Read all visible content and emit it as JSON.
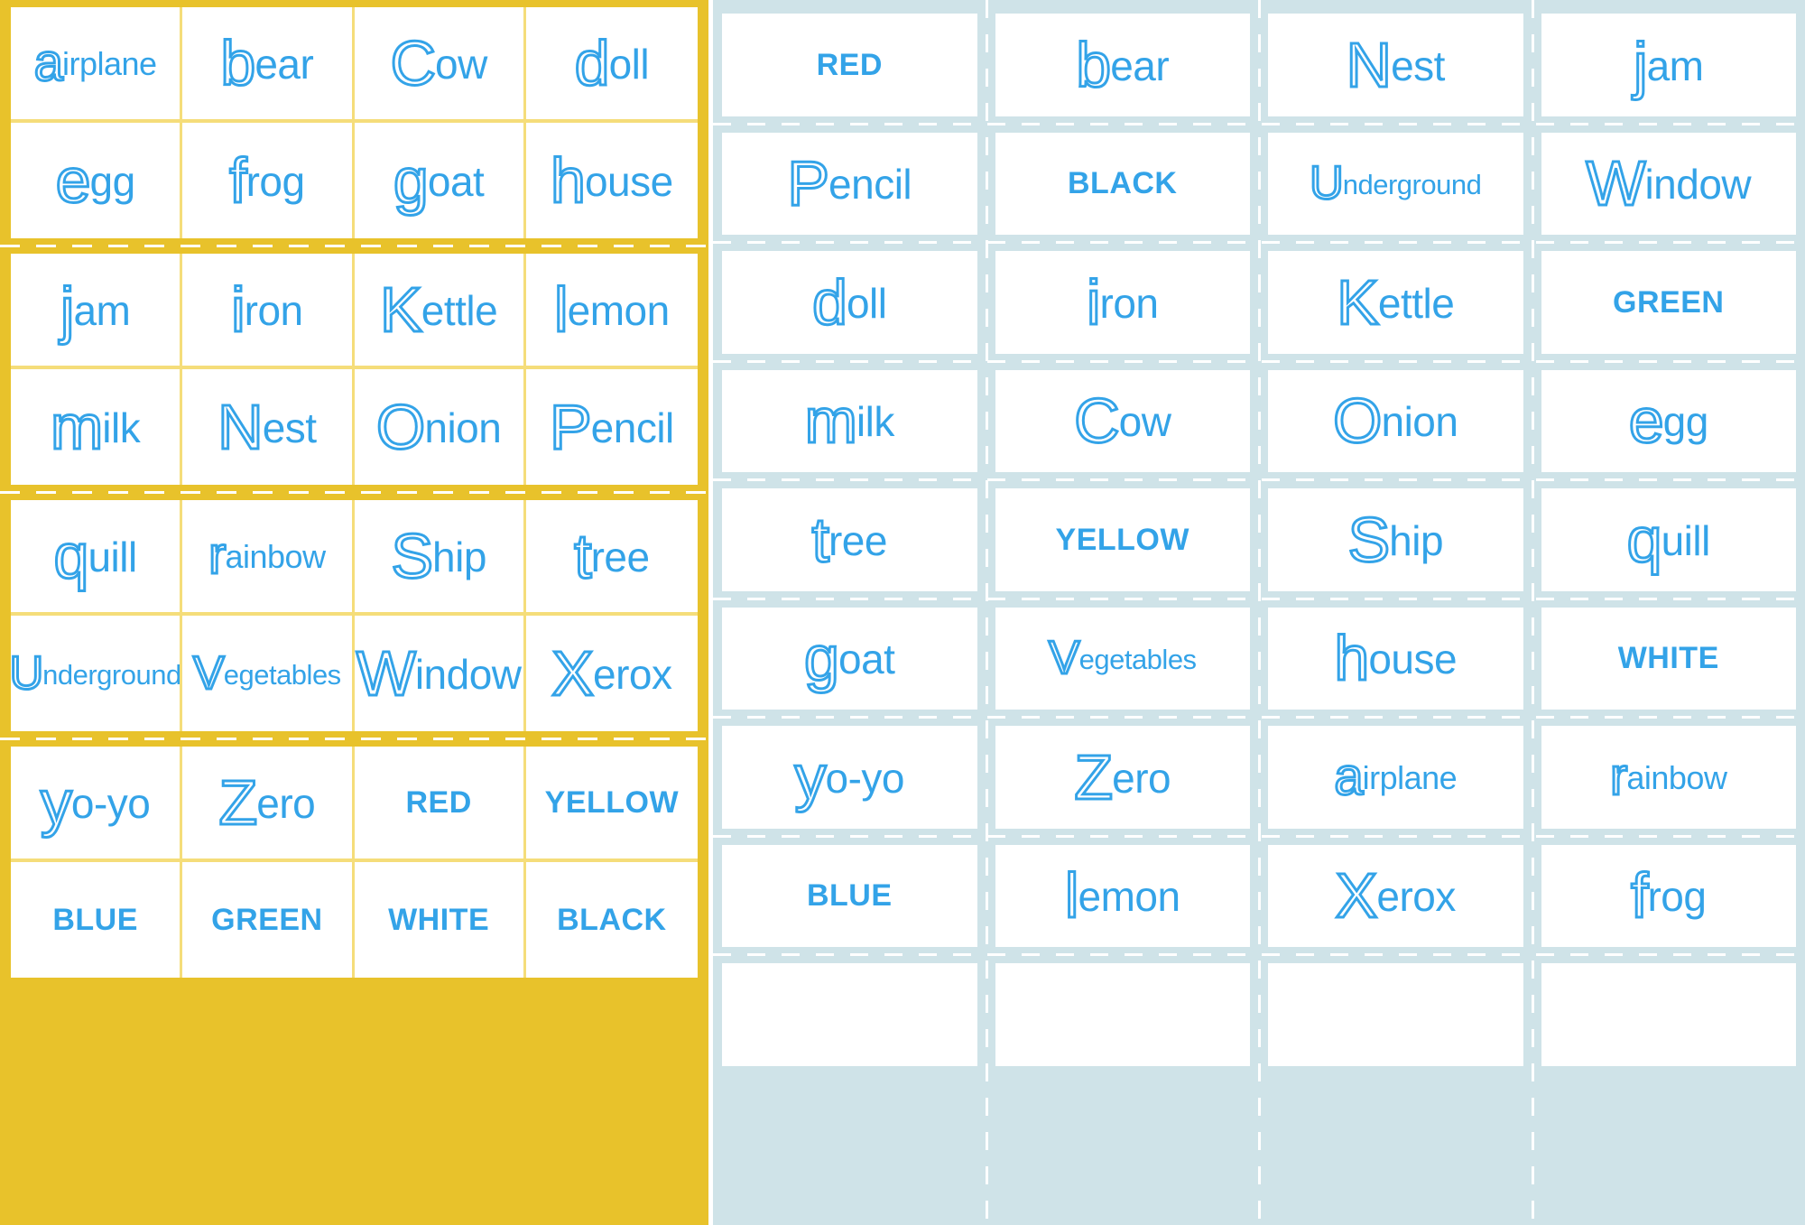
{
  "meta": {
    "accent_yellow": "#e8c22b",
    "accent_yellow_light": "#f5dd7a",
    "accent_blue_bg": "#cfe3e8",
    "word_blue": "#33a3e8",
    "card_white": "#ffffff"
  },
  "left_sheet": {
    "name": "alphabet-flashcard-sheet-yellow",
    "columns": 4,
    "blocks": [
      {
        "rows": [
          [
            {
              "text": "airplane",
              "initial": "a",
              "rest": "irplane",
              "style": "picture"
            },
            {
              "text": "bear",
              "initial": "b",
              "rest": "ear",
              "style": "picture"
            },
            {
              "text": "Cow",
              "initial": "C",
              "rest": "ow",
              "style": "picture"
            },
            {
              "text": "doll",
              "initial": "d",
              "rest": "oll",
              "style": "picture"
            }
          ],
          [
            {
              "text": "egg",
              "initial": "e",
              "rest": "gg",
              "style": "picture"
            },
            {
              "text": "frog",
              "initial": "f",
              "rest": "rog",
              "style": "picture"
            },
            {
              "text": "goat",
              "initial": "g",
              "rest": "oat",
              "style": "picture"
            },
            {
              "text": "house",
              "initial": "h",
              "rest": "ouse",
              "style": "picture"
            }
          ]
        ]
      },
      {
        "rows": [
          [
            {
              "text": "jam",
              "initial": "j",
              "rest": "am",
              "style": "picture"
            },
            {
              "text": "iron",
              "initial": "i",
              "rest": "ron",
              "style": "picture"
            },
            {
              "text": "Kettle",
              "initial": "K",
              "rest": "ettle",
              "style": "picture"
            },
            {
              "text": "lemon",
              "initial": "l",
              "rest": "emon",
              "style": "picture"
            }
          ],
          [
            {
              "text": "milk",
              "initial": "m",
              "rest": "ilk",
              "style": "picture"
            },
            {
              "text": "Nest",
              "initial": "N",
              "rest": "est",
              "style": "picture"
            },
            {
              "text": "Onion",
              "initial": "O",
              "rest": "nion",
              "style": "picture"
            },
            {
              "text": "Pencil",
              "initial": "P",
              "rest": "encil",
              "style": "picture"
            }
          ]
        ]
      },
      {
        "rows": [
          [
            {
              "text": "quill",
              "initial": "q",
              "rest": "uill",
              "style": "picture"
            },
            {
              "text": "rainbow",
              "initial": "r",
              "rest": "ainbow",
              "style": "picture"
            },
            {
              "text": "Ship",
              "initial": "S",
              "rest": "hip",
              "style": "picture"
            },
            {
              "text": "tree",
              "initial": "t",
              "rest": "ree",
              "style": "picture"
            }
          ],
          [
            {
              "text": "Underground",
              "initial": "U",
              "rest": "nderground",
              "style": "picture"
            },
            {
              "text": "Vegetables",
              "initial": "V",
              "rest": "egetables",
              "style": "picture"
            },
            {
              "text": "Window",
              "initial": "W",
              "rest": "indow",
              "style": "picture"
            },
            {
              "text": "Xerox",
              "initial": "X",
              "rest": "erox",
              "style": "picture"
            }
          ]
        ]
      },
      {
        "rows": [
          [
            {
              "text": "yo-yo",
              "initial": "y",
              "rest": "o-yo",
              "style": "picture"
            },
            {
              "text": "Zero",
              "initial": "Z",
              "rest": "ero",
              "style": "picture"
            },
            {
              "text": "RED",
              "initial": "",
              "rest": "",
              "style": "color"
            },
            {
              "text": "YELLOW",
              "initial": "",
              "rest": "",
              "style": "color"
            }
          ],
          [
            {
              "text": "BLUE",
              "initial": "",
              "rest": "",
              "style": "color"
            },
            {
              "text": "GREEN",
              "initial": "",
              "rest": "",
              "style": "color"
            },
            {
              "text": "WHITE",
              "initial": "",
              "rest": "",
              "style": "color"
            },
            {
              "text": "BLACK",
              "initial": "",
              "rest": "",
              "style": "color"
            }
          ]
        ]
      }
    ]
  },
  "right_sheet": {
    "name": "alphabet-flashcard-sheet-blue",
    "columns": 4,
    "rows": [
      [
        {
          "text": "RED",
          "initial": "",
          "rest": "",
          "style": "color"
        },
        {
          "text": "bear",
          "initial": "b",
          "rest": "ear",
          "style": "picture"
        },
        {
          "text": "Nest",
          "initial": "N",
          "rest": "est",
          "style": "picture"
        },
        {
          "text": "jam",
          "initial": "j",
          "rest": "am",
          "style": "picture"
        }
      ],
      [
        {
          "text": "Pencil",
          "initial": "P",
          "rest": "encil",
          "style": "picture"
        },
        {
          "text": "BLACK",
          "initial": "",
          "rest": "",
          "style": "color"
        },
        {
          "text": "Underground",
          "initial": "U",
          "rest": "nderground",
          "style": "picture"
        },
        {
          "text": "Window",
          "initial": "W",
          "rest": "indow",
          "style": "picture"
        }
      ],
      [
        {
          "text": "doll",
          "initial": "d",
          "rest": "oll",
          "style": "picture"
        },
        {
          "text": "iron",
          "initial": "i",
          "rest": "ron",
          "style": "picture"
        },
        {
          "text": "Kettle",
          "initial": "K",
          "rest": "ettle",
          "style": "picture"
        },
        {
          "text": "GREEN",
          "initial": "",
          "rest": "",
          "style": "color"
        }
      ],
      [
        {
          "text": "milk",
          "initial": "m",
          "rest": "ilk",
          "style": "picture"
        },
        {
          "text": "Cow",
          "initial": "C",
          "rest": "ow",
          "style": "picture"
        },
        {
          "text": "Onion",
          "initial": "O",
          "rest": "nion",
          "style": "picture"
        },
        {
          "text": "egg",
          "initial": "e",
          "rest": "gg",
          "style": "picture"
        }
      ],
      [
        {
          "text": "tree",
          "initial": "t",
          "rest": "ree",
          "style": "picture"
        },
        {
          "text": "YELLOW",
          "initial": "",
          "rest": "",
          "style": "color"
        },
        {
          "text": "Ship",
          "initial": "S",
          "rest": "hip",
          "style": "picture"
        },
        {
          "text": "quill",
          "initial": "q",
          "rest": "uill",
          "style": "picture"
        }
      ],
      [
        {
          "text": "goat",
          "initial": "g",
          "rest": "oat",
          "style": "picture"
        },
        {
          "text": "Vegetables",
          "initial": "V",
          "rest": "egetables",
          "style": "picture"
        },
        {
          "text": "house",
          "initial": "h",
          "rest": "ouse",
          "style": "picture"
        },
        {
          "text": "WHITE",
          "initial": "",
          "rest": "",
          "style": "color"
        }
      ],
      [
        {
          "text": "yo-yo",
          "initial": "y",
          "rest": "o-yo",
          "style": "picture"
        },
        {
          "text": "Zero",
          "initial": "Z",
          "rest": "ero",
          "style": "picture"
        },
        {
          "text": "airplane",
          "initial": "a",
          "rest": "irplane",
          "style": "picture"
        },
        {
          "text": "rainbow",
          "initial": "r",
          "rest": "ainbow",
          "style": "picture"
        }
      ],
      [
        {
          "text": "BLUE",
          "initial": "",
          "rest": "",
          "style": "color"
        },
        {
          "text": "lemon",
          "initial": "l",
          "rest": "emon",
          "style": "picture"
        },
        {
          "text": "Xerox",
          "initial": "X",
          "rest": "erox",
          "style": "picture"
        },
        {
          "text": "frog",
          "initial": "f",
          "rest": "rog",
          "style": "picture"
        }
      ],
      [
        {
          "text": "",
          "initial": "",
          "rest": "",
          "style": "blank"
        },
        {
          "text": "",
          "initial": "",
          "rest": "",
          "style": "blank"
        },
        {
          "text": "",
          "initial": "",
          "rest": "",
          "style": "blank"
        },
        {
          "text": "",
          "initial": "",
          "rest": "",
          "style": "blank"
        }
      ]
    ]
  }
}
